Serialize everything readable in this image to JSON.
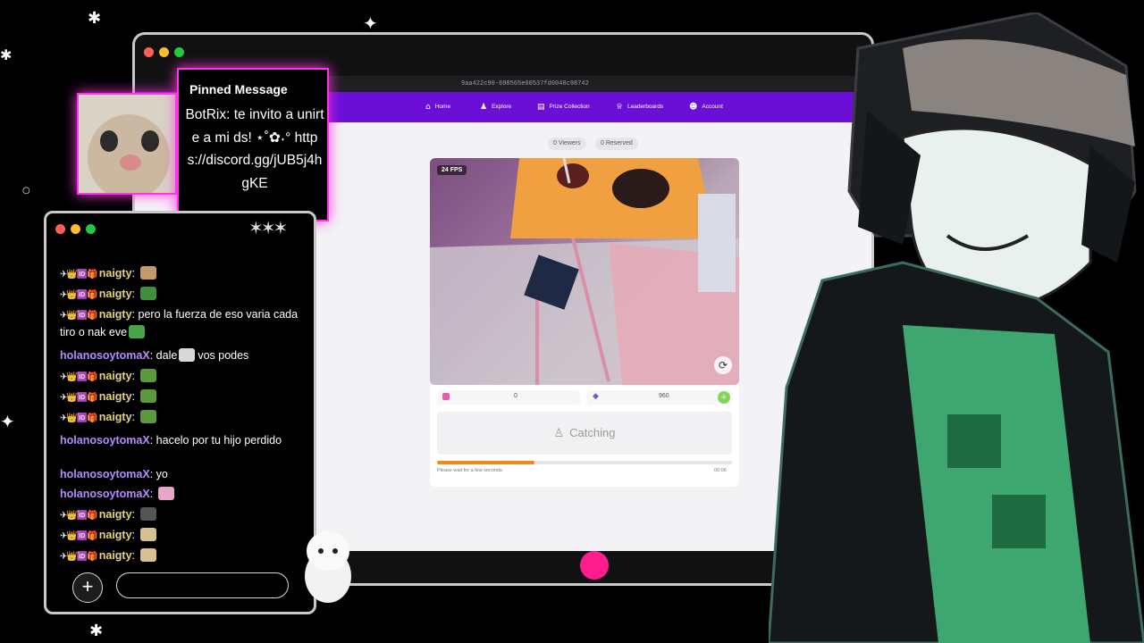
{
  "browser": {
    "url": "9aa422c90-698565e00537fd0048c98742",
    "nav": [
      {
        "label": "Home",
        "icon": "home-icon",
        "glyph": "⌂"
      },
      {
        "label": "Explore",
        "icon": "explore-icon",
        "glyph": "♟"
      },
      {
        "label": "Prize Collection",
        "icon": "prize-icon",
        "glyph": "▤"
      },
      {
        "label": "Leaderboards",
        "icon": "leaderboard-icon",
        "glyph": "♕"
      },
      {
        "label": "Account",
        "icon": "account-icon",
        "glyph": "☻"
      }
    ],
    "viewers": "0 Viewers",
    "reserved": "0 Reserved",
    "fps": "24 FPS",
    "coins": "0",
    "gems": "960",
    "catching": "Catching",
    "wait_text": "Please wait for a few seconds",
    "timer": "00:06",
    "progress": 0.33,
    "colors": {
      "nav": "#6b0fd6",
      "progress": "#f08a1a",
      "add": "#7ed957"
    }
  },
  "pinned": {
    "title": "Pinned Message",
    "text": "BotRix: te invito a unirte a mi ds! ⋆˚✿˖° https://discord.gg/jUB5j4hgKE",
    "border_color": "#ff35e5"
  },
  "chat": {
    "messages": [
      {
        "badges": "✈👑🆔🎁",
        "user": "naigty",
        "text": "",
        "emote": "#c49a6c"
      },
      {
        "badges": "✈👑🆔🎁",
        "user": "naigty",
        "text": "",
        "emote": "#3f8f3f"
      },
      {
        "badges": "✈👑🆔🎁",
        "user": "naigty",
        "text": "pero la fuerza de eso varia cada tiro o nak eve",
        "emote": "#4aa54a"
      },
      {
        "badges": "",
        "user": "holanosoytomaX",
        "text": "dale",
        "after": "vos podes",
        "emote": "#d9d9d9"
      },
      {
        "badges": "✈👑🆔🎁",
        "user": "naigty",
        "text": "",
        "emote": "#5a9a3c"
      },
      {
        "badges": "✈👑🆔🎁",
        "user": "naigty",
        "text": "",
        "emote": "#5a9a3c"
      },
      {
        "badges": "✈👑🆔🎁",
        "user": "naigty",
        "text": "",
        "emote": "#5a9a3c"
      },
      {
        "badges": "",
        "user": "holanosoytomaX",
        "text": "hacelo por tu hijo perdido",
        "emote": ""
      },
      {
        "badges": "",
        "user": "holanosoytomaX",
        "text": "yo",
        "emote": ""
      },
      {
        "badges": "",
        "user": "holanosoytomaX",
        "text": "",
        "emote": "#e8a6c8"
      },
      {
        "badges": "✈👑🆔🎁",
        "user": "naigty",
        "text": "",
        "emote": "#555555"
      },
      {
        "badges": "✈👑🆔🎁",
        "user": "naigty",
        "text": "",
        "emote": "#d8c090"
      },
      {
        "badges": "✈👑🆔🎁",
        "user": "naigty",
        "text": "",
        "emote": "#d8c090"
      }
    ],
    "input_placeholder": ""
  }
}
